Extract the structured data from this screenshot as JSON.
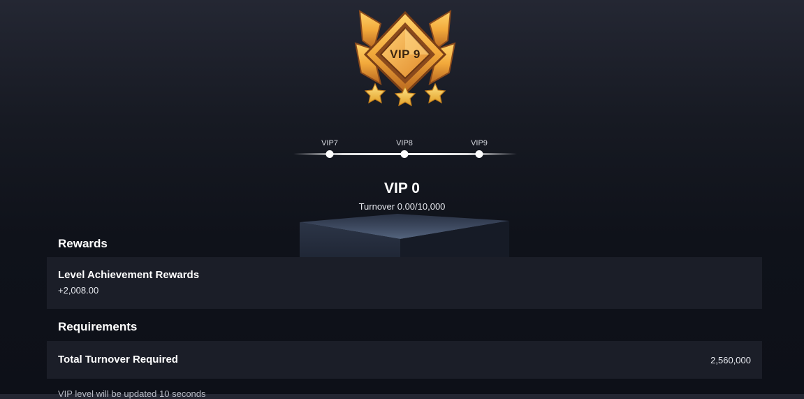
{
  "badge": {
    "label": "VIP 9"
  },
  "timeline": {
    "levels": [
      {
        "label": "VIP7"
      },
      {
        "label": "VIP8"
      },
      {
        "label": "VIP9"
      }
    ]
  },
  "status": {
    "title": "VIP 0",
    "turnover": "Turnover 0.00/10,000"
  },
  "rewards": {
    "section_title": "Rewards",
    "card_title": "Level Achievement Rewards",
    "card_value": "+2,008.00"
  },
  "requirements": {
    "section_title": "Requirements",
    "card_title": "Total Turnover Required",
    "card_value": "2,560,000"
  },
  "footnote": "VIP level will be updated 10 seconds",
  "colors": {
    "background_top": "#242733",
    "background_bottom": "#0d1018",
    "card": "#1b1e28",
    "badge_gold": "#f2a93b",
    "badge_dark": "#8a4a1c"
  }
}
